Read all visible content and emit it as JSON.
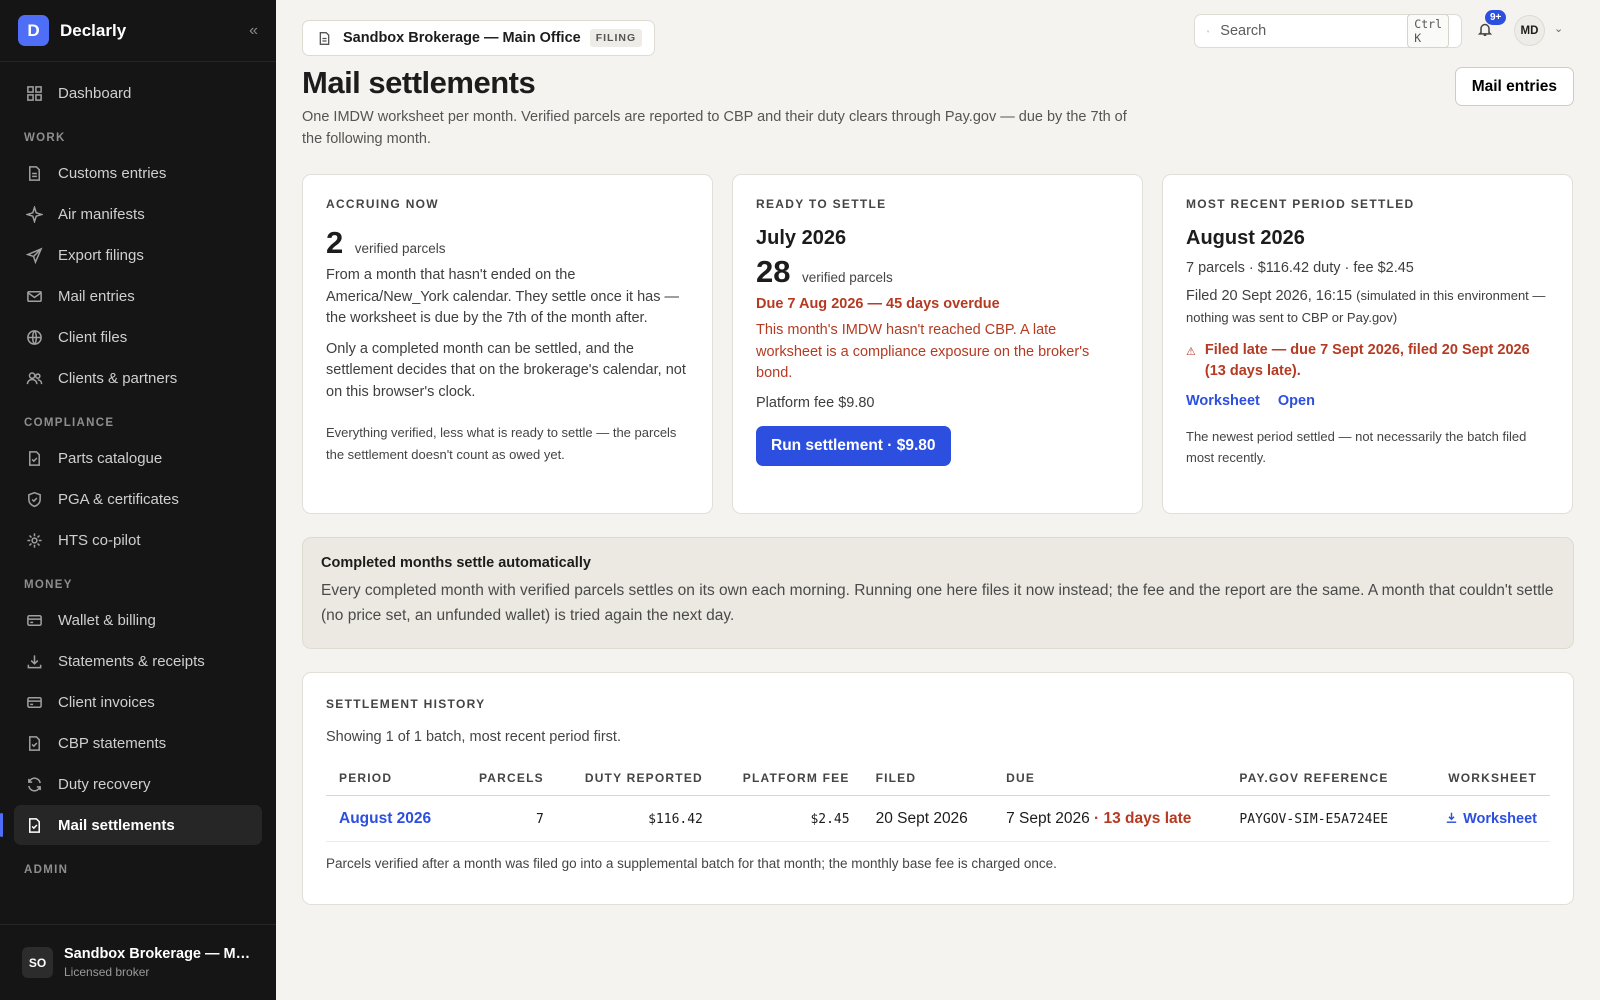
{
  "brand": {
    "logo_letter": "D",
    "name": "Declarly",
    "collapse_glyph": "«"
  },
  "nav": {
    "dashboard": "Dashboard",
    "sections": {
      "work": "WORK",
      "compliance": "COMPLIANCE",
      "money": "MONEY",
      "admin": "ADMIN"
    },
    "work_items": [
      "Customs entries",
      "Air manifests",
      "Export filings",
      "Mail entries",
      "Client files",
      "Clients & partners"
    ],
    "compliance_items": [
      "Parts catalogue",
      "PGA & certificates",
      "HTS co-pilot"
    ],
    "money_items": [
      "Wallet & billing",
      "Statements & receipts",
      "Client invoices",
      "CBP statements",
      "Duty recovery",
      "Mail settlements"
    ]
  },
  "org": {
    "avatar": "SO",
    "name": "Sandbox Brokerage — Main Office",
    "role": "Licensed broker"
  },
  "topbar": {
    "context_name": "Sandbox Brokerage — Main Office",
    "context_badge": "FILING",
    "search_placeholder": "Search",
    "search_shortcut": "Ctrl K",
    "notifications_badge": "9+",
    "user_initials": "MD"
  },
  "page": {
    "title": "Mail settlements",
    "description": "One IMDW worksheet per month. Verified parcels are reported to CBP and their duty clears through Pay.gov — due by the 7th of the following month.",
    "mail_entries_button": "Mail entries"
  },
  "accruing": {
    "eyebrow": "ACCRUING NOW",
    "count": "2",
    "count_label": "verified parcels",
    "p1": "From a month that hasn't ended on the America/New_York calendar. They settle once it has — the worksheet is due by the 7th of the month after.",
    "p2": "Only a completed month can be settled, and the settlement decides that on the brokerage's calendar, not on this browser's clock.",
    "note": "Everything verified, less what is ready to settle — the parcels the settlement doesn't count as owed yet."
  },
  "ready": {
    "eyebrow": "READY TO SETTLE",
    "period": "July 2026",
    "count": "28",
    "count_label": "verified parcels",
    "due": "Due 7 Aug 2026 — 45 days overdue",
    "warning": "This month's IMDW hasn't reached CBP. A late worksheet is a compliance exposure on the broker's bond.",
    "fee": "Platform fee $9.80",
    "button": "Run settlement · $9.80"
  },
  "recent": {
    "eyebrow": "MOST RECENT PERIOD SETTLED",
    "period": "August 2026",
    "summary": "7 parcels · $116.42 duty · fee $2.45",
    "filed": "Filed 20 Sept 2026, 16:15",
    "filed_note": "(simulated in this environment — nothing was sent to CBP or Pay.gov)",
    "late_glyph": "⚠",
    "late": "Filed late — due 7 Sept 2026, filed 20 Sept 2026 (13 days late).",
    "link_worksheet": "Worksheet",
    "link_open": "Open",
    "note": "The newest period settled — not necessarily the batch filed most recently."
  },
  "banner": {
    "title": "Completed months settle automatically",
    "text": "Every completed month with verified parcels settles on its own each morning. Running one here files it now instead; the fee and the report are the same. A month that couldn't settle (no price set, an unfunded wallet) is tried again the next day."
  },
  "history": {
    "eyebrow": "SETTLEMENT HISTORY",
    "subtitle": "Showing 1 of 1 batch, most recent period first.",
    "columns": [
      "PERIOD",
      "PARCELS",
      "DUTY REPORTED",
      "PLATFORM FEE",
      "FILED",
      "DUE",
      "PAY.GOV REFERENCE",
      "WORKSHEET"
    ],
    "rows": [
      {
        "period": "August 2026",
        "parcels": "7",
        "duty": "$116.42",
        "fee": "$2.45",
        "filed": "20 Sept 2026",
        "due": "7 Sept 2026",
        "late": "· 13 days late",
        "reference": "PAYGOV-SIM-E5A724EE",
        "worksheet": "Worksheet"
      }
    ],
    "footnote": "Parcels verified after a month was filed go into a supplemental batch for that month; the monthly base fee is charged once."
  }
}
